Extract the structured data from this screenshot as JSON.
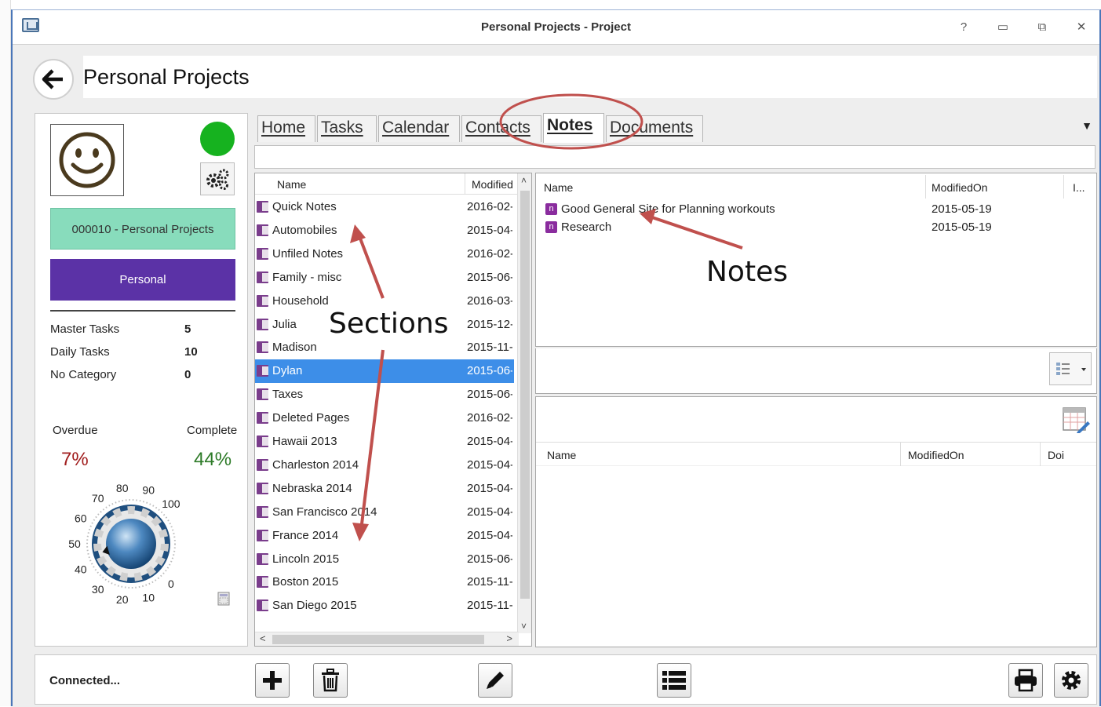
{
  "window": {
    "title": "Personal Projects - Project",
    "help_label": "?",
    "minimize_label": "▭",
    "restore_label": "⧉",
    "close_label": "✕"
  },
  "header": {
    "project_title": "Personal Projects"
  },
  "left_panel": {
    "project_code": "000010 - Personal Projects",
    "category": "Personal",
    "status_color": "#16b21f",
    "category_color": "#5b32a6",
    "code_color": "#88dcbc",
    "stats": [
      {
        "label": "Master Tasks",
        "value": "5"
      },
      {
        "label": "Daily Tasks",
        "value": "10"
      },
      {
        "label": "No Category",
        "value": "0"
      }
    ],
    "overdue_label": "Overdue",
    "complete_label": "Complete",
    "overdue_value": "7%",
    "complete_value": "44%",
    "gauge_ticks": [
      "0",
      "10",
      "20",
      "30",
      "40",
      "50",
      "60",
      "70",
      "80",
      "90",
      "100"
    ],
    "gauge_level": 0.44
  },
  "tabs": [
    {
      "label": "Home",
      "active": false
    },
    {
      "label": "Tasks",
      "active": false
    },
    {
      "label": "Calendar",
      "active": false
    },
    {
      "label": "Contacts",
      "active": false
    },
    {
      "label": "Notes",
      "active": true
    },
    {
      "label": "Documents",
      "active": false
    }
  ],
  "sections": {
    "col_name": "Name",
    "col_modified": "Modified",
    "rows": [
      {
        "name": "Quick Notes",
        "modified": "2016-02-"
      },
      {
        "name": "Automobiles",
        "modified": "2015-04-"
      },
      {
        "name": "Unfiled Notes",
        "modified": "2016-02-"
      },
      {
        "name": "Family - misc",
        "modified": "2015-06-"
      },
      {
        "name": "Household",
        "modified": "2016-03-"
      },
      {
        "name": "Julia",
        "modified": "2015-12-"
      },
      {
        "name": "Madison",
        "modified": "2015-11-"
      },
      {
        "name": "Dylan",
        "modified": "2015-06-",
        "selected": true
      },
      {
        "name": "Taxes",
        "modified": "2015-06-"
      },
      {
        "name": "Deleted Pages",
        "modified": "2016-02-"
      },
      {
        "name": "Hawaii 2013",
        "modified": "2015-04-"
      },
      {
        "name": "Charleston 2014",
        "modified": "2015-04-"
      },
      {
        "name": "Nebraska 2014",
        "modified": "2015-04-"
      },
      {
        "name": "San Francisco 2014",
        "modified": "2015-04-"
      },
      {
        "name": "France 2014",
        "modified": "2015-04-"
      },
      {
        "name": "Lincoln 2015",
        "modified": "2015-06-"
      },
      {
        "name": "Boston 2015",
        "modified": "2015-11-"
      },
      {
        "name": "San Diego 2015",
        "modified": "2015-11-"
      }
    ]
  },
  "notes": {
    "col_name": "Name",
    "col_modified": "ModifiedOn",
    "col_extra": "I...",
    "rows": [
      {
        "name": "Good General Site for Planning workouts",
        "modified": "2015-05-19"
      },
      {
        "name": "Research",
        "modified": "2015-05-19"
      }
    ]
  },
  "documents": {
    "col_name": "Name",
    "col_modified": "ModifiedOn",
    "col_extra": "Doi"
  },
  "status": {
    "text": "Connected..."
  },
  "annotations": {
    "sections": "Sections",
    "notes": "Notes",
    "color": "#c0504d"
  }
}
